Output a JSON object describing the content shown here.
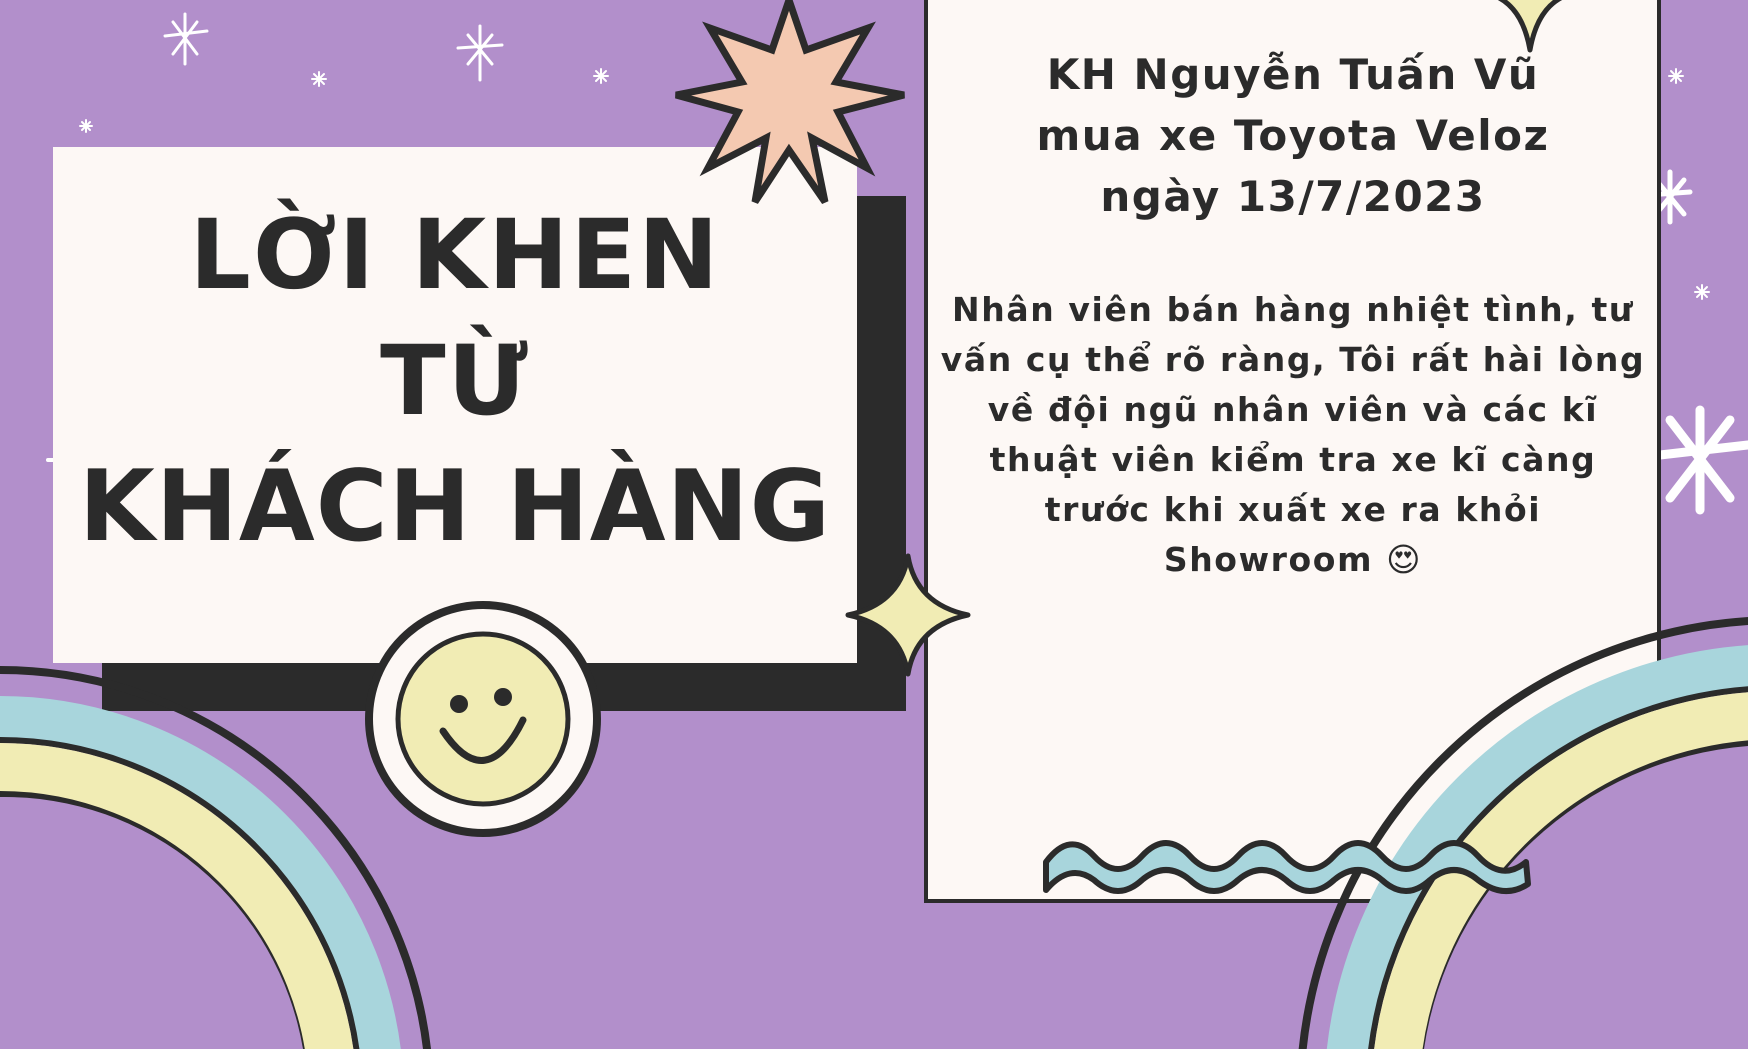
{
  "title": {
    "line1": "Lời khen",
    "line2": "từ",
    "line3": "Khách hàng"
  },
  "review": {
    "heading_line1": "KH Nguyễn Tuấn Vũ",
    "heading_line2": "mua xe Toyota Veloz",
    "heading_line3": "ngày 13/7/2023",
    "body": "Nhân viên bán hàng nhiệt tình, tư vấn cụ thể rõ ràng, Tôi rất hài lòng về đội ngũ nhân viên và các kĩ thuật viên kiểm tra xe kĩ càng trước khi xuất xe ra khỏi Showroom 😍"
  },
  "colors": {
    "background": "#b28fcb",
    "card": "#fdf8f5",
    "outline": "#2b2b2b",
    "smiley": "#f1ecb4",
    "starburst": "#f4c9b1",
    "rainbow_blue": "#a8d5dc",
    "rainbow_yellow": "#f1ecb4"
  },
  "icons": [
    "sparkle-icon",
    "starburst-icon",
    "four-point-star-icon",
    "smiley-icon",
    "wave-icon",
    "rainbow-icon"
  ]
}
